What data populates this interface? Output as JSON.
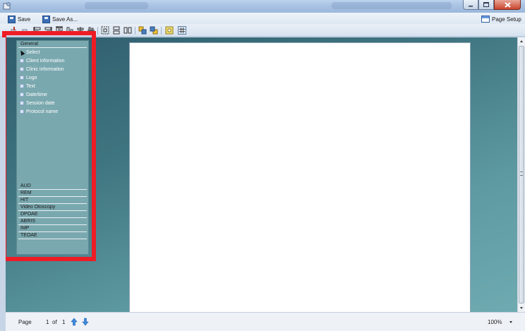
{
  "toolbar": {
    "save_label": "Save",
    "save_as_label": "Save As...",
    "page_setup_label": "Page Setup"
  },
  "palette": {
    "general_header": "General",
    "general_items": [
      {
        "label": "Select",
        "icon": "pointer-icon"
      },
      {
        "label": "Client information",
        "icon": "box-icon"
      },
      {
        "label": "Clinic information",
        "icon": "box-icon"
      },
      {
        "label": "Logo",
        "icon": "box-icon"
      },
      {
        "label": "Text",
        "icon": "box-icon"
      },
      {
        "label": "Date/time",
        "icon": "box-icon"
      },
      {
        "label": "Session date",
        "icon": "box-icon"
      },
      {
        "label": "Protocol name",
        "icon": "box-icon"
      }
    ],
    "sections": [
      "AUD",
      "REM",
      "HIT",
      "Video Otoscopy",
      "DPOAE",
      "ABRIS",
      "IMP",
      "TEOAE"
    ]
  },
  "statusbar": {
    "page_label": "Page",
    "page_current": "1",
    "of_label": "of",
    "page_total": "1",
    "zoom": "100%"
  },
  "colors": {
    "highlight": "#ee1c25",
    "workspace": "#3f7580",
    "palette_bg": "#7aa8af"
  }
}
